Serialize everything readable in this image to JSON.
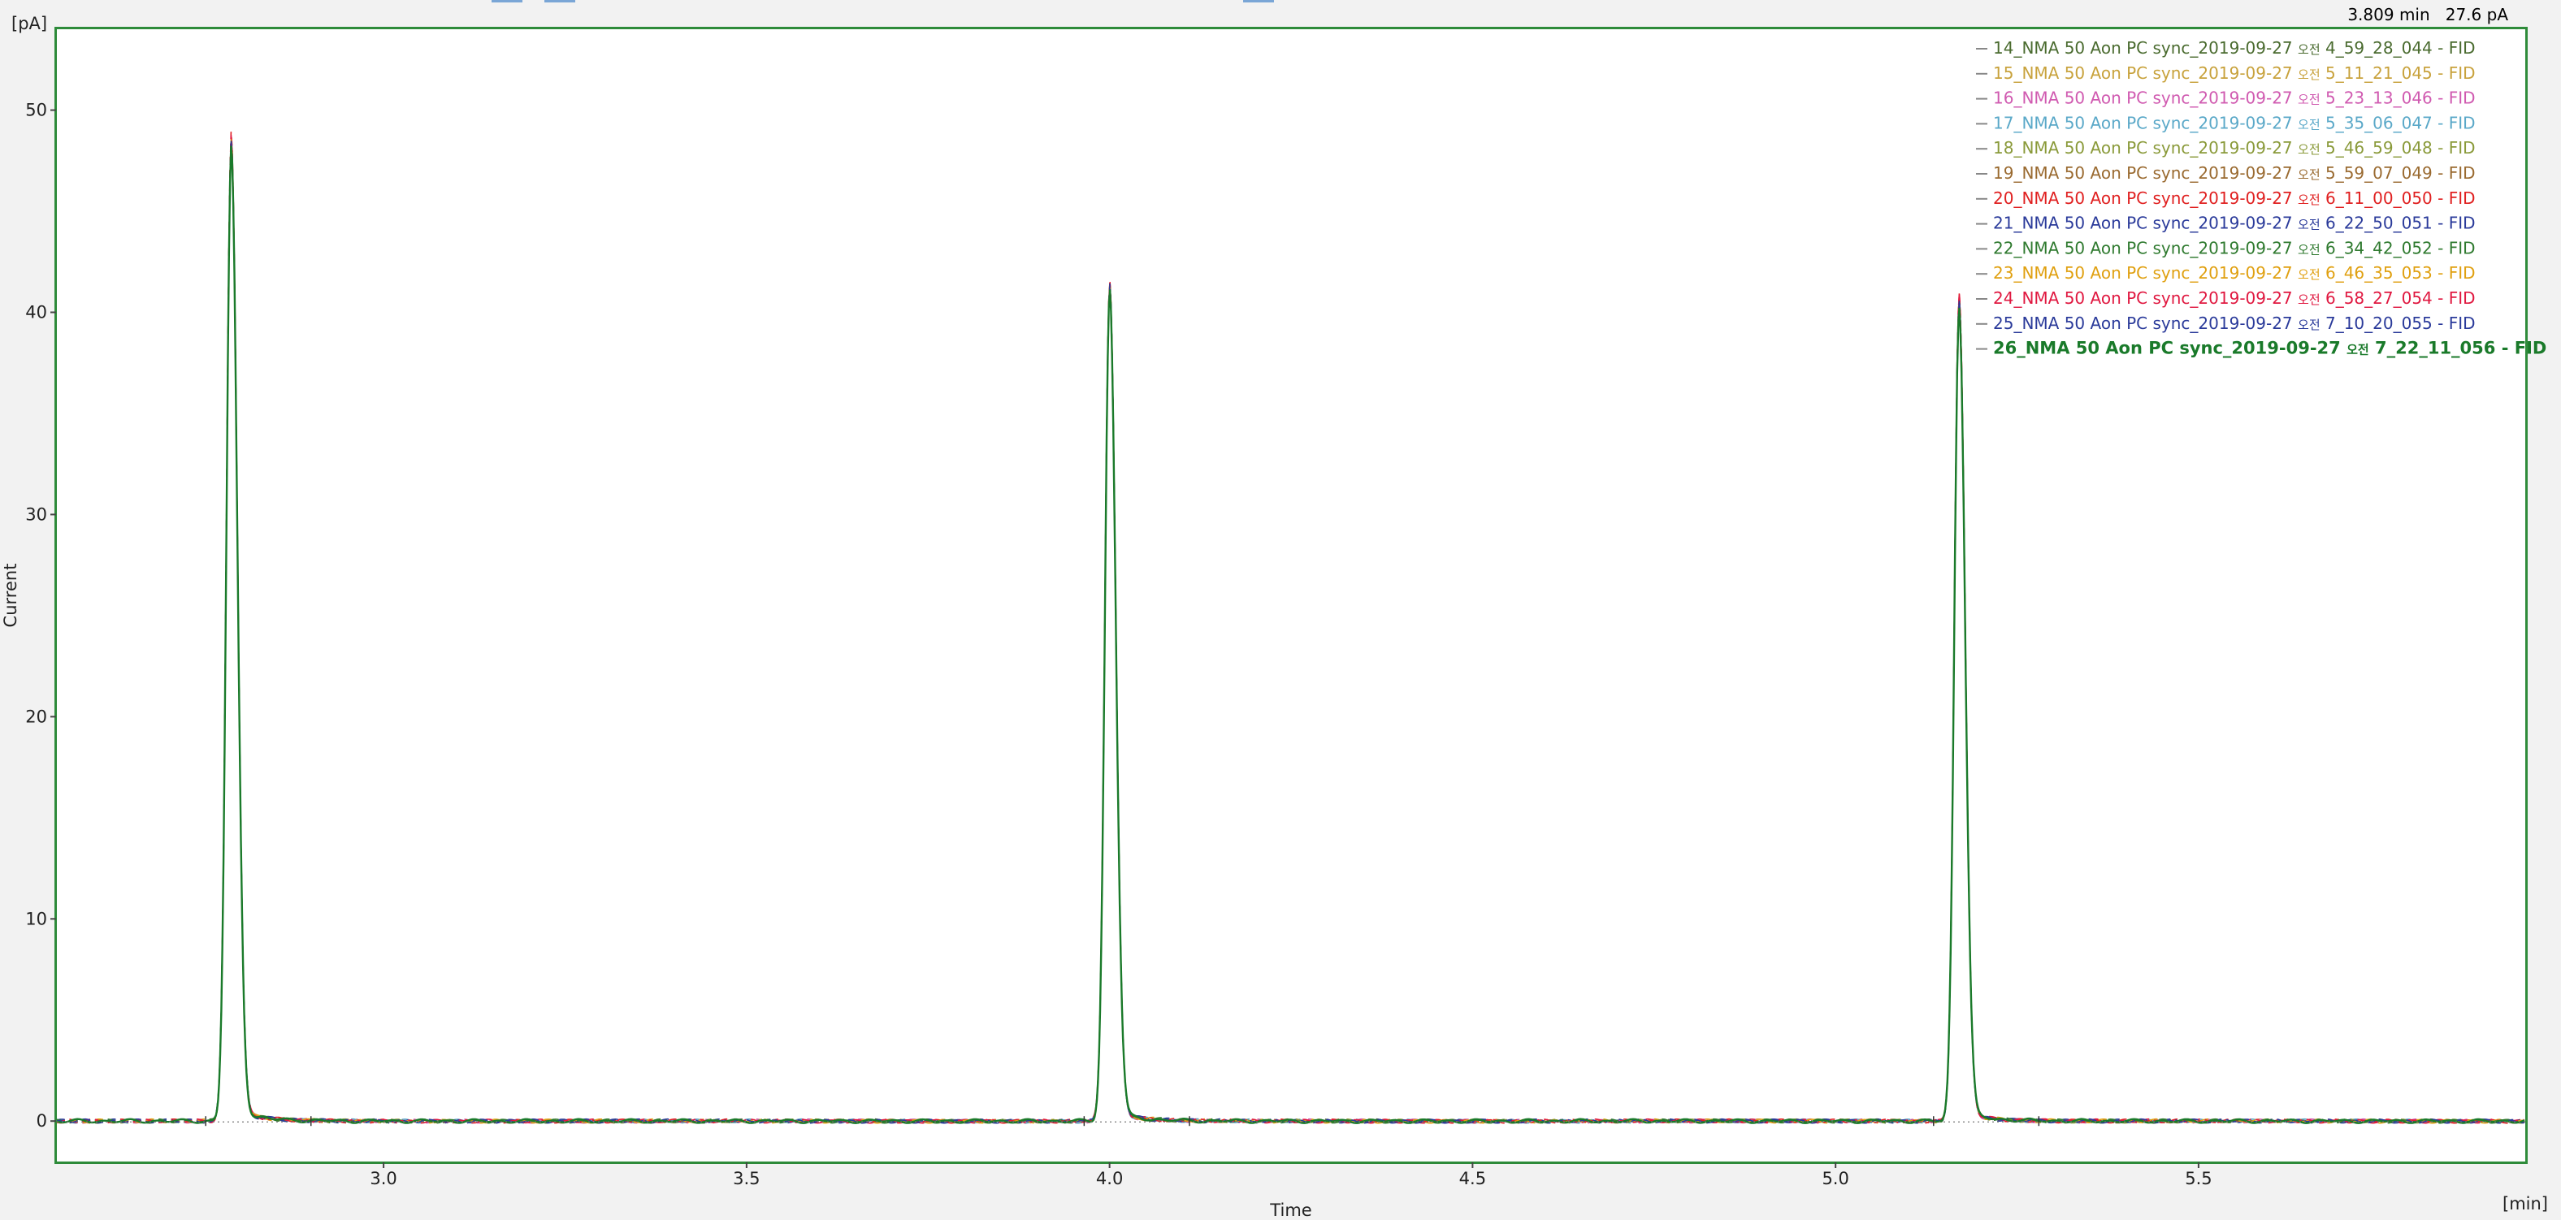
{
  "cursor_readout": {
    "time": "3.809 min",
    "value": "27.6 pA"
  },
  "chart_data": {
    "type": "line",
    "title": "",
    "xlabel": "Time",
    "xunit": "[min]",
    "ylabel": "Current",
    "yunit": "[pA]",
    "xlim": [
      2.55,
      5.95
    ],
    "ylim": [
      -2,
      54
    ],
    "xticks": [
      3.0,
      3.5,
      4.0,
      4.5,
      5.0,
      5.5
    ],
    "xtick_labels": [
      "3.0",
      "3.5",
      "4.0",
      "4.5",
      "5.0",
      "5.5"
    ],
    "yticks": [
      0,
      10,
      20,
      30,
      40,
      50
    ],
    "ytick_labels": [
      "0",
      "10",
      "20",
      "30",
      "40",
      "50"
    ],
    "grid": false,
    "legend_position": "top-right",
    "peaks": [
      {
        "retention_time": 2.79,
        "height": 48
      },
      {
        "retention_time": 4.0,
        "height": 41
      },
      {
        "retention_time": 5.17,
        "height": 40.5
      }
    ],
    "series": [
      {
        "name": "14_NMA 50 Aon PC sync_2019-09-27 오전 4_59_28_044 - FID",
        "color": "#4a6b2f",
        "peak_heights": [
          48.0,
          41.0,
          40.2
        ]
      },
      {
        "name": "15_NMA 50 Aon PC sync_2019-09-27 오전 5_11_21_045 - FID",
        "color": "#c8a23c",
        "peak_heights": [
          47.9,
          40.9,
          40.1
        ]
      },
      {
        "name": "16_NMA 50 Aon PC sync_2019-09-27 오전 5_23_13_046 - FID",
        "color": "#d05ab0",
        "peak_heights": [
          48.1,
          41.0,
          40.3
        ]
      },
      {
        "name": "17_NMA 50 Aon PC sync_2019-09-27 오전 5_35_06_047 - FID",
        "color": "#5aa8c8",
        "peak_heights": [
          47.8,
          40.8,
          40.0
        ]
      },
      {
        "name": "18_NMA 50 Aon PC sync_2019-09-27 오전 5_46_59_048 - FID",
        "color": "#8a9a3a",
        "peak_heights": [
          48.0,
          41.1,
          40.2
        ]
      },
      {
        "name": "19_NMA 50 Aon PC sync_2019-09-27 오전 5_59_07_049 - FID",
        "color": "#9a6a30",
        "peak_heights": [
          47.9,
          40.9,
          40.1
        ]
      },
      {
        "name": "20_NMA 50 Aon PC sync_2019-09-27 오전 6_11_00_050 - FID",
        "color": "#e02020",
        "peak_heights": [
          48.3,
          41.2,
          40.6
        ]
      },
      {
        "name": "21_NMA 50 Aon PC sync_2019-09-27 오전 6_22_50_051 - FID",
        "color": "#2a3a9a",
        "peak_heights": [
          48.0,
          41.0,
          40.2
        ]
      },
      {
        "name": "22_NMA 50 Aon PC sync_2019-09-27 오전 6_34_42_052 - FID",
        "color": "#2f7a2f",
        "peak_heights": [
          47.9,
          40.9,
          40.1
        ]
      },
      {
        "name": "23_NMA 50 Aon PC sync_2019-09-27 오전 6_46_35_053 - FID",
        "color": "#e0a010",
        "peak_heights": [
          48.0,
          41.0,
          40.2
        ]
      },
      {
        "name": "24_NMA 50 Aon PC sync_2019-09-27 오전 6_58_27_054 - FID",
        "color": "#e01840",
        "peak_heights": [
          48.2,
          41.1,
          40.5
        ]
      },
      {
        "name": "25_NMA 50 Aon PC sync_2019-09-27 오전 7_10_20_055 - FID",
        "color": "#2a3a9a",
        "peak_heights": [
          48.0,
          41.0,
          40.2
        ]
      },
      {
        "name": "26_NMA 50 Aon PC sync_2019-09-27 오전 7_22_11_056 - FID",
        "color": "#1a7a2a",
        "peak_heights": [
          47.6,
          40.7,
          39.9
        ],
        "highlighted": true
      }
    ]
  }
}
